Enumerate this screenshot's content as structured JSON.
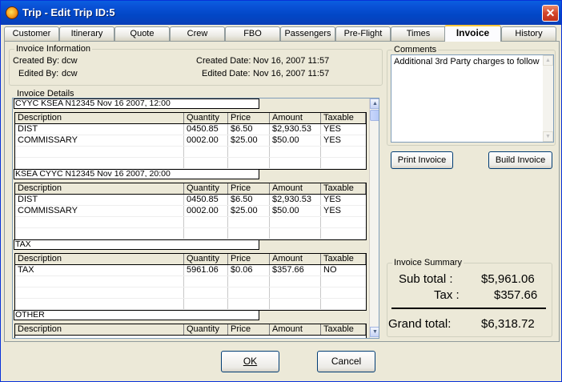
{
  "window": {
    "title": "Trip - Edit Trip ID:5",
    "close_glyph": "✕"
  },
  "tabs": [
    {
      "label": "Customer"
    },
    {
      "label": "Itinerary"
    },
    {
      "label": "Quote"
    },
    {
      "label": "Crew"
    },
    {
      "label": "FBO"
    },
    {
      "label": "Passengers"
    },
    {
      "label": "Pre-Flight"
    },
    {
      "label": "Times"
    },
    {
      "label": "Invoice"
    },
    {
      "label": "History"
    }
  ],
  "active_tab": "Invoice",
  "invoice_info": {
    "group_title": "Invoice Information",
    "created_by_label": "Created By:",
    "created_by": "dcw",
    "edited_by_label": "Edited By:",
    "edited_by": "dcw",
    "created_date_label": "Created Date:",
    "created_date": "Nov 16, 2007 11:57",
    "edited_date_label": "Edited Date:",
    "edited_date": "Nov 16, 2007 11:57"
  },
  "invoice_details": {
    "group_title": "Invoice Details",
    "columns": [
      "Description",
      "Quantity",
      "Price",
      "Amount",
      "Taxable"
    ],
    "sections": [
      {
        "header": "CYYC KSEA N12345 Nov 16 2007, 12:00",
        "rows": [
          [
            "DIST",
            "0450.85",
            "$6.50",
            "$2,930.53",
            "YES"
          ],
          [
            "COMMISSARY",
            "0002.00",
            "$25.00",
            "$50.00",
            "YES"
          ]
        ]
      },
      {
        "header": "KSEA CYYC N12345 Nov 16 2007, 20:00",
        "rows": [
          [
            "DIST",
            "0450.85",
            "$6.50",
            "$2,930.53",
            "YES"
          ],
          [
            "COMMISSARY",
            "0002.00",
            "$25.00",
            "$50.00",
            "YES"
          ]
        ]
      },
      {
        "header": "TAX",
        "rows": [
          [
            "TAX",
            "5961.06",
            "$0.06",
            "$357.66",
            "NO"
          ]
        ]
      },
      {
        "header": "OTHER",
        "rows": []
      }
    ]
  },
  "comments": {
    "group_title": "Comments",
    "text": "Additional 3rd Party charges to follow"
  },
  "buttons": {
    "print_invoice": "Print Invoice",
    "build_invoice": "Build Invoice",
    "ok": "OK",
    "cancel": "Cancel"
  },
  "summary": {
    "group_title": "Invoice Summary",
    "subtotal_label": "Sub total :",
    "subtotal": "$5,961.06",
    "tax_label": "Tax :",
    "tax": "$357.66",
    "grand_total_label": "Grand total:",
    "grand_total": "$6,318.72"
  },
  "colors": {
    "title_bar": "#0147c6",
    "active_tab_accent": "#ffc83c",
    "close_button": "#d4452a"
  },
  "icons": {
    "app": "app-orb-icon",
    "close": "close-icon",
    "scroll_up": "scroll-up-arrow-icon",
    "scroll_down": "scroll-down-arrow-icon"
  }
}
